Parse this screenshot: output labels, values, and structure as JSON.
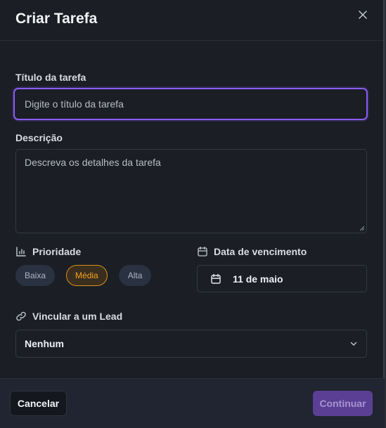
{
  "dialog": {
    "title": "Criar Tarefa",
    "close_icon": "close-icon"
  },
  "form": {
    "title_label": "Título da tarefa",
    "title_placeholder": "Digite o título da tarefa",
    "title_value": "",
    "description_label": "Descrição",
    "description_placeholder": "Descreva os detalhes da tarefa",
    "description_value": "",
    "priority": {
      "label": "Prioridade",
      "icon": "bar-chart-icon",
      "options": [
        "Baixa",
        "Média",
        "Alta"
      ],
      "selected": "Média"
    },
    "due_date": {
      "label": "Data de vencimento",
      "icon": "calendar-icon",
      "value": "11 de maio"
    },
    "lead": {
      "label": "Vincular a um Lead",
      "icon": "link-icon",
      "selected": "Nenhum"
    }
  },
  "footer": {
    "cancel_label": "Cancelar",
    "continue_label": "Continuar"
  },
  "colors": {
    "accent": "#8b5cf6",
    "priority_active": "#f5a623",
    "background": "#1b1e25",
    "footer": "#202531",
    "continue_button": "#5b3f94"
  }
}
